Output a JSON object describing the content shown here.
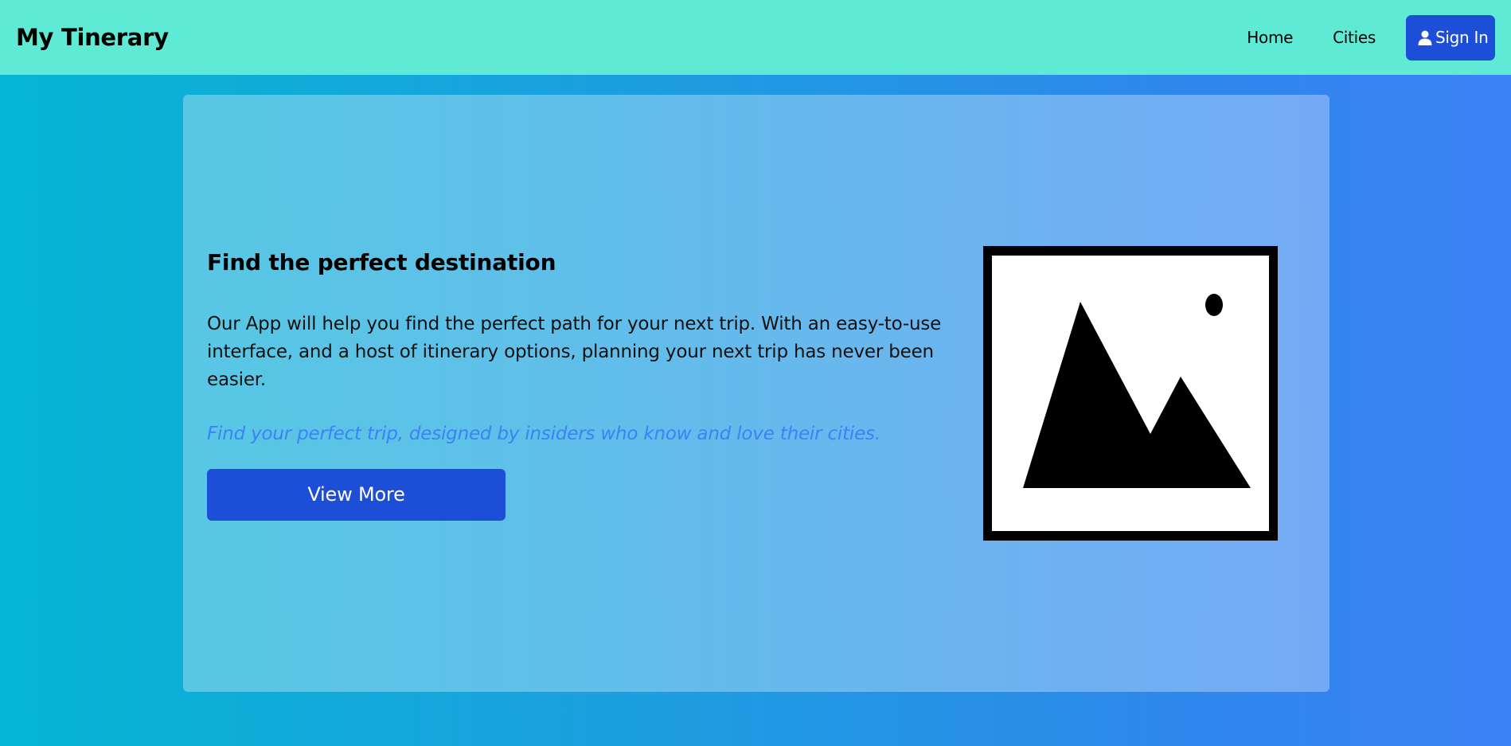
{
  "header": {
    "brand": "My Tinerary",
    "nav": {
      "home": "Home",
      "cities": "Cities",
      "sign_in": "Sign In"
    }
  },
  "hero": {
    "headline": "Find the perfect destination",
    "description": "Our App will help you find the perfect path for your next trip. With an easy-to-use interface, and a host of itinerary options, planning your next trip has never been easier.",
    "tagline": "Find your perfect trip, designed by insiders who know and love their cities.",
    "cta": "View More",
    "image_icon": "image-placeholder-icon"
  },
  "colors": {
    "navbar": "#5eead4",
    "primary_button": "#1d4ed8",
    "tagline": "#3b82f6",
    "background_start": "#06b6d4",
    "background_end": "#3b82f6"
  }
}
